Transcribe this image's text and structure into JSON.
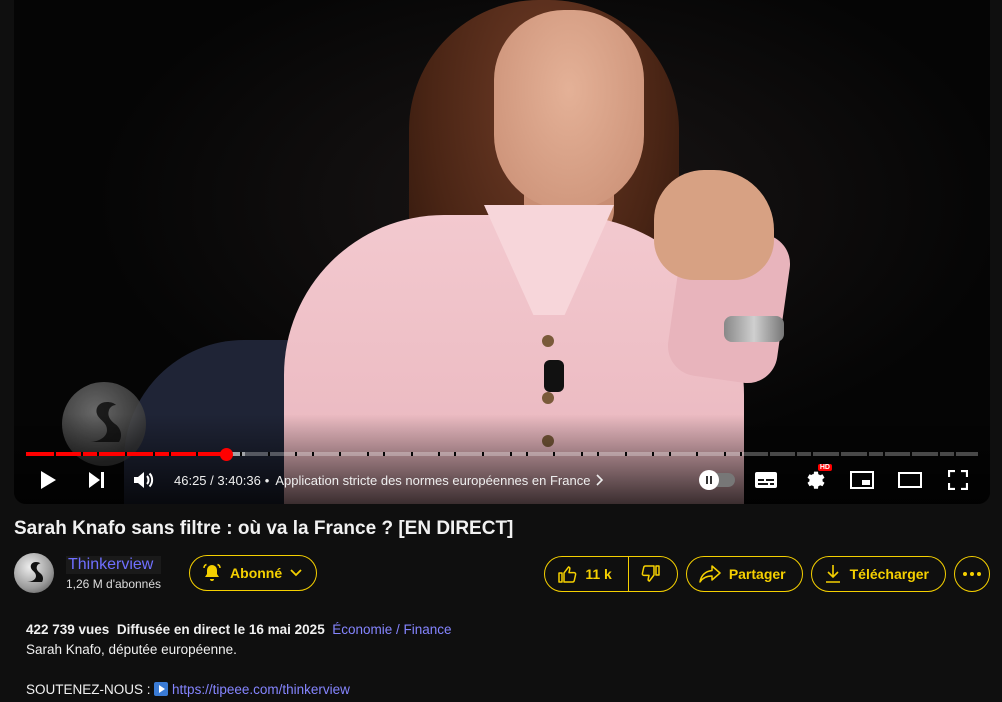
{
  "player": {
    "current_time": "46:25",
    "separator": "/",
    "duration": "3:40:36",
    "bullet": "•",
    "chapter_title": "Application stricte des normes européennes en France",
    "progress_fraction": 0.2103,
    "loaded_fraction": 0.23,
    "hd_label": "HD"
  },
  "video": {
    "title": "Sarah Knafo sans filtre : où va la France ? [EN DIRECT]"
  },
  "channel": {
    "name": "Thinkerview",
    "subscribers": "1,26 M d'abonnés",
    "subscribe_label": "Abonné"
  },
  "actions": {
    "like_count": "11 k",
    "share_label": "Partager",
    "download_label": "Télécharger"
  },
  "description": {
    "views": "422 739 vues",
    "date": "Diffusée en direct le 16 mai 2025",
    "category": "Économie / Finance",
    "line1": "Sarah Knafo, députée européenne.",
    "support_label": "SOUTENEZ-NOUS :",
    "support_link": "https://tipeee.com/thinkerview"
  },
  "colors": {
    "accent": "#f5d000",
    "progress": "#ff0000",
    "link": "#8585ff",
    "background": "#0f0f0f"
  },
  "icons": {
    "play": "play-icon",
    "next": "next-icon",
    "volume": "volume-icon",
    "subtitles": "subtitles-icon",
    "settings": "gear-icon",
    "miniplayer": "miniplayer-icon",
    "theater": "theater-icon",
    "fullscreen": "fullscreen-icon",
    "bell": "bell-icon",
    "like": "thumbs-up-icon",
    "dislike": "thumbs-down-icon",
    "share": "share-icon",
    "download": "download-icon",
    "more": "more-icon"
  }
}
